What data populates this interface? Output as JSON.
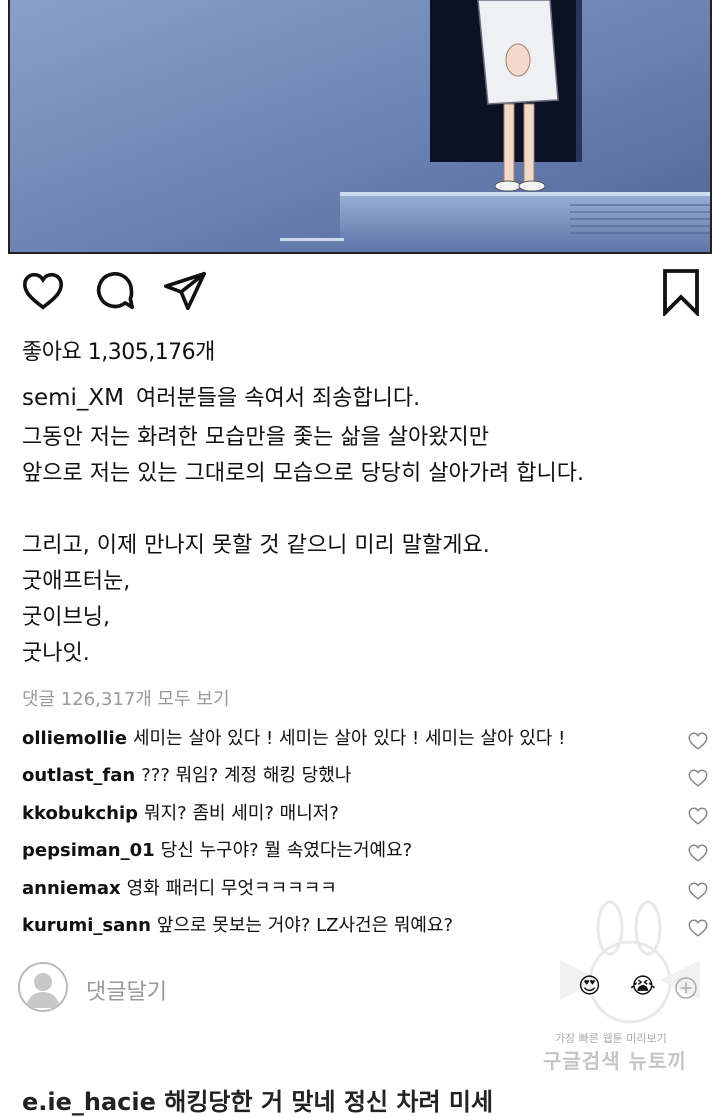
{
  "post": {
    "likes_text": "좋아요 1,305,176개",
    "username": "semi_XM",
    "caption_first": "여러분들을 속여서 죄송합니다.",
    "caption_lines": [
      "그동안 저는 화려한 모습만을 좇는 삶을 살아왔지만",
      "앞으로 저는 있는 그대로의 모습으로 당당히 살아가려 합니다.",
      "",
      "그리고, 이제 만나지 못할 것 같으니 미리 말할게요.",
      "굿애프터눈,",
      "굿이브닝,",
      "굿나잇."
    ],
    "view_all_comments": "댓글 126,317개 모두 보기"
  },
  "icons": {
    "like": "heart-outline-icon",
    "comment": "speech-bubble-icon",
    "share": "paper-plane-icon",
    "save": "bookmark-icon"
  },
  "comments": [
    {
      "user": "olliemollie",
      "text": "세미는 살아 있다 ! 세미는 살아 있다 ! 세미는 살아 있다 !"
    },
    {
      "user": "outlast_fan",
      "text": "??? 뭐임? 계정 해킹 당했나"
    },
    {
      "user": "kkobukchip",
      "text": "뭐지? 좀비 세미? 매니저?"
    },
    {
      "user": "pepsiman_01",
      "text": "당신 누구야? 뭘 속였다는거예요?"
    },
    {
      "user": "anniemax",
      "text": "영화 패러디 무엇ㅋㅋㅋㅋㅋ"
    },
    {
      "user": "kurumi_sann",
      "text": "앞으로 못보는 거야? LZ사건은 뭐예요?"
    }
  ],
  "add_comment": {
    "placeholder": "댓글달기",
    "emoji_1": "😍",
    "emoji_2": "😭",
    "plus_icon": "plus-circle-icon"
  },
  "watermark": {
    "line1": "가장 빠른 웹툰 미리보기",
    "line2": "구글검색 뉴토끼"
  },
  "next_comment_partial": "e.ie_hacie 해킹당한 거 맞네 정신 차려 미세"
}
